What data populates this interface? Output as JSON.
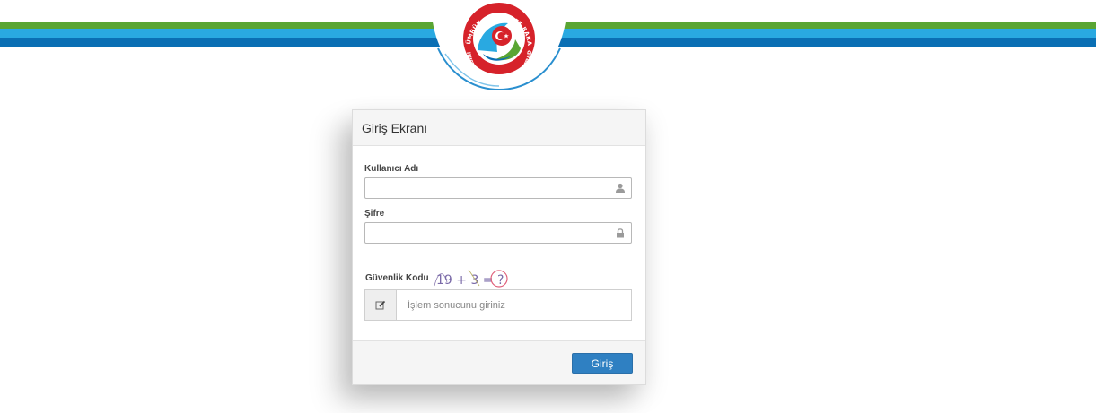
{
  "header": {
    "logo": {
      "ring_text_top": "T.C. GÜMRÜK ve TİCARET BAKANLIĞI",
      "ring_text_bottom": "MINISTRY OF CUSTOMS AND TRADE"
    },
    "stripe_colors": [
      "#5aa533",
      "#29a9e1",
      "#0a6fb4"
    ]
  },
  "login": {
    "title": "Giriş Ekranı",
    "username_label": "Kullanıcı Adı",
    "username_value": "",
    "password_label": "Şifre",
    "password_value": "",
    "captcha_label": "Güvenlik Kodu",
    "captcha_text": "19 + 3 = ?",
    "captcha_placeholder": "İşlem sonucunu giriniz",
    "captcha_value": "",
    "submit_label": "Giriş"
  },
  "colors": {
    "primary_button": "#2f80c2"
  }
}
